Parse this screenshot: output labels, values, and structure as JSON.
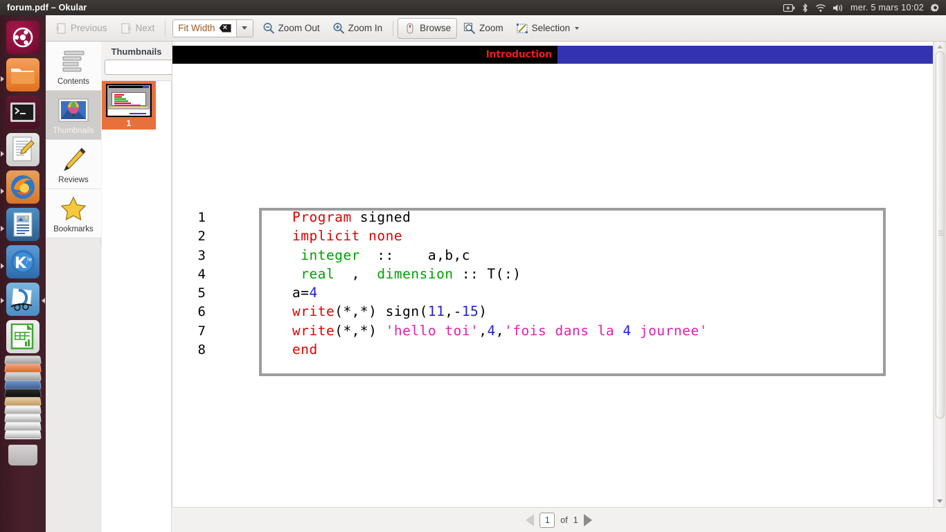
{
  "window": {
    "title": "forum.pdf – Okular"
  },
  "top_panel": {
    "clock": "mer. 5 mars  10:02",
    "icons": [
      "battery-icon",
      "bluetooth-icon",
      "wifi-icon",
      "volume-icon",
      "gear-icon"
    ]
  },
  "launcher": {
    "items": [
      {
        "name": "ubuntu-dash-icon",
        "label": "Ubuntu"
      },
      {
        "name": "files-icon",
        "label": "Files"
      },
      {
        "name": "terminal-icon",
        "label": "Terminal"
      },
      {
        "name": "text-editor-icon",
        "label": "Text Editor"
      },
      {
        "name": "firefox-icon",
        "label": "Firefox"
      },
      {
        "name": "libreoffice-impress-icon",
        "label": "LibreOffice Impress"
      },
      {
        "name": "kile-icon",
        "label": "Kile"
      },
      {
        "name": "okular-icon",
        "label": "Okular"
      },
      {
        "name": "libreoffice-calc-icon",
        "label": "LibreOffice Calc"
      },
      {
        "name": "trash-icon",
        "label": "Trash"
      }
    ]
  },
  "toolbar": {
    "previous_label": "Previous",
    "next_label": "Next",
    "zoom_select_value": "Fit Width",
    "zoom_out_label": "Zoom Out",
    "zoom_in_label": "Zoom In",
    "browse_label": "Browse",
    "zoom_tool_label": "Zoom",
    "selection_label": "Selection"
  },
  "sidebar": {
    "items": [
      {
        "label": "Contents",
        "icon": "contents-icon",
        "selected": false
      },
      {
        "label": "Thumbnails",
        "icon": "thumbnails-icon",
        "selected": true
      },
      {
        "label": "Reviews",
        "icon": "pencil-icon",
        "selected": false
      },
      {
        "label": "Bookmarks",
        "icon": "star-icon",
        "selected": false
      }
    ]
  },
  "thumbnails": {
    "title": "Thumbnails",
    "filter_placeholder": "",
    "filter_value": "",
    "filter_icon": "funnel-icon",
    "pages": [
      {
        "number": "1",
        "selected": true
      }
    ]
  },
  "document": {
    "banner_title": "Introduction",
    "banner_colors": {
      "black": "#000000",
      "blue": "#3333b2",
      "title": "#f01a1a"
    },
    "code": {
      "lines": [
        {
          "n": "1",
          "tokens": [
            {
              "t": "Program",
              "c": "kw"
            },
            {
              "t": " signed",
              "c": "pl"
            }
          ]
        },
        {
          "n": "2",
          "tokens": [
            {
              "t": "implicit none",
              "c": "kw"
            }
          ]
        },
        {
          "n": "3",
          "tokens": [
            {
              "t": " integer",
              "c": "ty"
            },
            {
              "t": "  ::    a,b,c",
              "c": "pl"
            }
          ]
        },
        {
          "n": "4",
          "tokens": [
            {
              "t": " real",
              "c": "ty"
            },
            {
              "t": "  ,  ",
              "c": "pl"
            },
            {
              "t": "dimension",
              "c": "ty"
            },
            {
              "t": " :: T(:)",
              "c": "pl"
            }
          ]
        },
        {
          "n": "5",
          "tokens": [
            {
              "t": "a=",
              "c": "pl"
            },
            {
              "t": "4",
              "c": "num2"
            }
          ]
        },
        {
          "n": "6",
          "tokens": [
            {
              "t": "write",
              "c": "kw"
            },
            {
              "t": "(*,*) sign(",
              "c": "pl"
            },
            {
              "t": "11",
              "c": "num2"
            },
            {
              "t": ",-",
              "c": "pl"
            },
            {
              "t": "15",
              "c": "num2"
            },
            {
              "t": ")",
              "c": "pl"
            }
          ]
        },
        {
          "n": "7",
          "tokens": [
            {
              "t": "write",
              "c": "kw"
            },
            {
              "t": "(*,*) ",
              "c": "pl"
            },
            {
              "t": "'hello toi'",
              "c": "str"
            },
            {
              "t": ",",
              "c": "pl"
            },
            {
              "t": "4",
              "c": "num2"
            },
            {
              "t": ",",
              "c": "pl"
            },
            {
              "t": "'fois dans la ",
              "c": "str"
            },
            {
              "t": "4",
              "c": "num2"
            },
            {
              "t": " journee'",
              "c": "str"
            }
          ]
        },
        {
          "n": "8",
          "tokens": [
            {
              "t": "end",
              "c": "kw"
            }
          ]
        }
      ],
      "syntax_colors": {
        "keyword": "#e00000",
        "type": "#00a000",
        "number": "#2020e0",
        "string": "#e020b0",
        "plain": "#000000"
      }
    }
  },
  "statusbar": {
    "current_page": "1",
    "of_label": "of",
    "total_pages": "1",
    "prev_icon": "triangle-left-icon",
    "next_icon": "triangle-right-icon"
  }
}
